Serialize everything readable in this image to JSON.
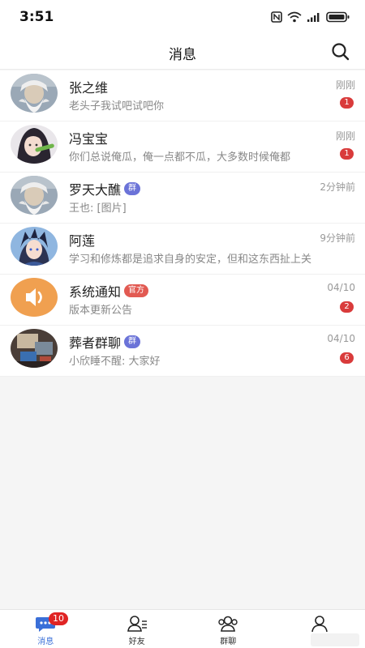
{
  "status_bar": {
    "time": "3:51"
  },
  "header": {
    "title": "消息"
  },
  "messages": [
    {
      "name": "张之维",
      "tag": "",
      "time": "刚刚",
      "preview": "老头子我试吧试吧你",
      "unread": "1"
    },
    {
      "name": "冯宝宝",
      "tag": "",
      "time": "刚刚",
      "preview": "你们总说俺瓜，俺一点都不瓜，大多数时候俺都",
      "unread": "1"
    },
    {
      "name": "罗天大醮",
      "tag": "群",
      "time": "2分钟前",
      "preview": "王也: [图片]",
      "unread": ""
    },
    {
      "name": "阿莲",
      "tag": "",
      "time": "9分钟前",
      "preview": "学习和修炼都是追求自身的安定，但和这东西扯上关",
      "unread": ""
    },
    {
      "name": "系统通知",
      "tag": "官方",
      "time": "04/10",
      "preview": "版本更新公告",
      "unread": "2"
    },
    {
      "name": "葬者群聊",
      "tag": "群",
      "time": "04/10",
      "preview": "小欣睡不醒: 大家好",
      "unread": "6"
    }
  ],
  "tabs": [
    {
      "label": "消息",
      "badge": "10",
      "active": true
    },
    {
      "label": "好友",
      "active": false
    },
    {
      "label": "群聊",
      "active": false
    },
    {
      "label": "我",
      "active": false
    }
  ],
  "colors": {
    "accent": "#3a6fd8",
    "badge": "#d93b3b",
    "group_tag": "#6b73d8",
    "official_tag": "#e25a52",
    "system_avatar": "#f0a050"
  }
}
